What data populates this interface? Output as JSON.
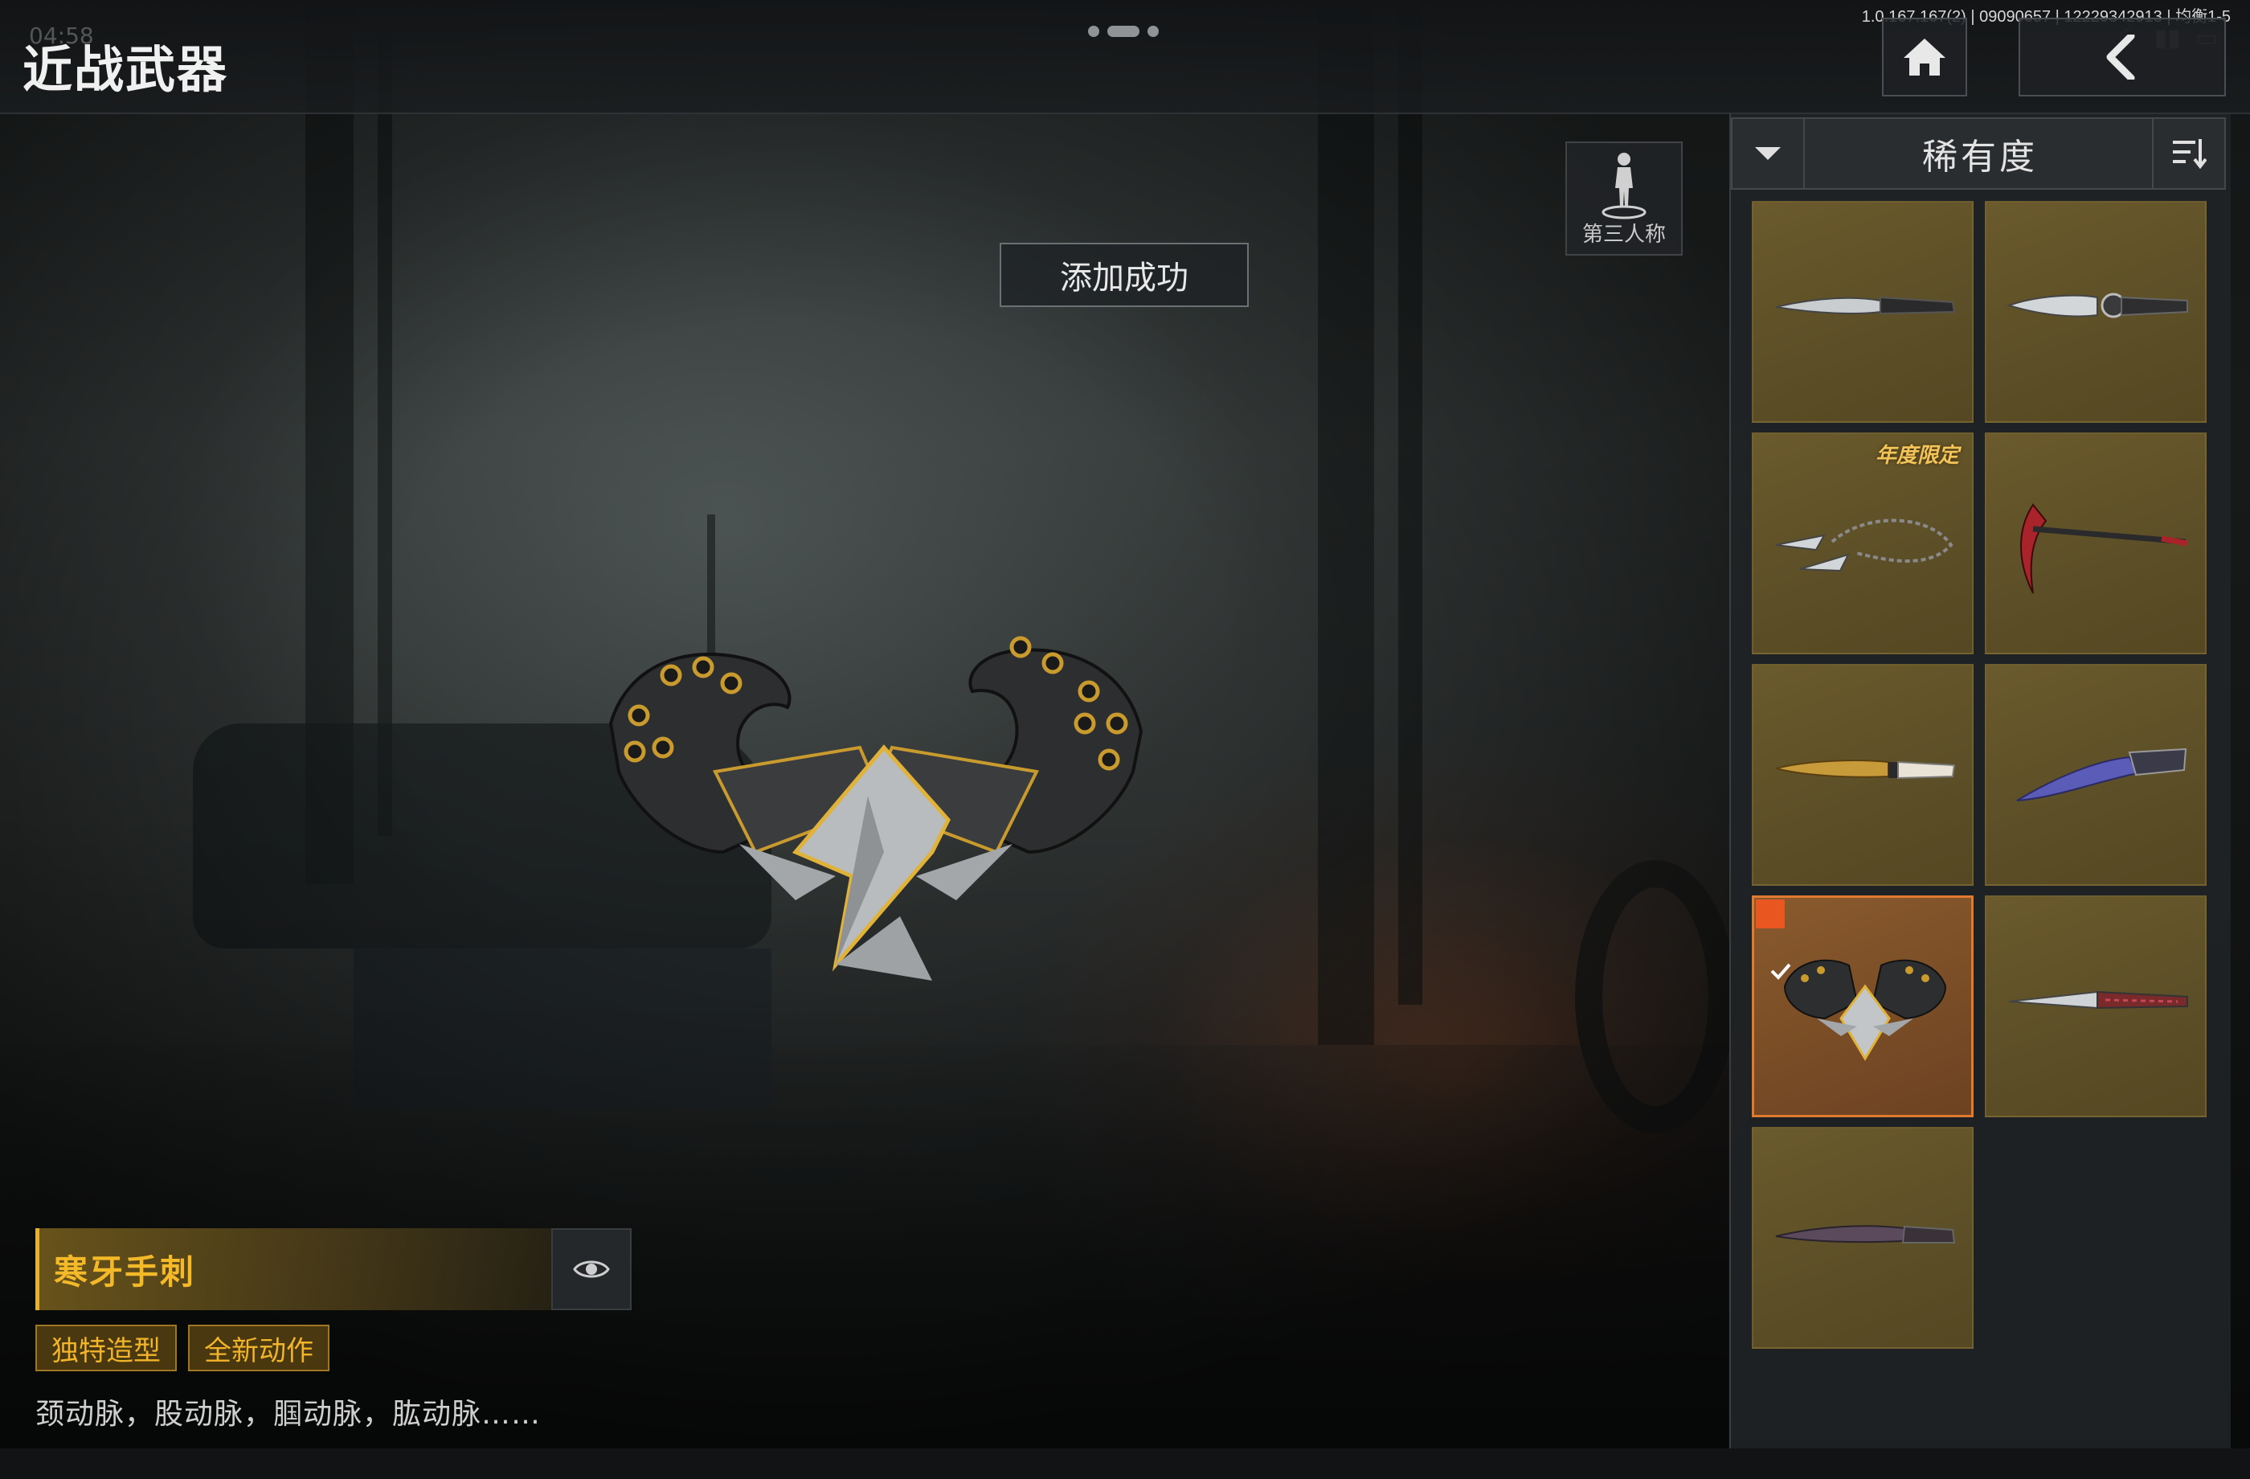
{
  "header": {
    "title": "近战武器",
    "clock": "04:58",
    "build_info": "1.0.167.167(2) | 09090657 | 12229342913 | 均衡1-5"
  },
  "nav": {
    "home_icon": "home-icon",
    "back_icon": "chevron-left-icon"
  },
  "toast": {
    "text": "添加成功"
  },
  "view_toggle": {
    "label": "第三人称",
    "icon": "person-icon"
  },
  "sort": {
    "label": "稀有度",
    "collapse_icon": "chevron-down-icon",
    "order_icon": "sort-order-icon"
  },
  "selected_item": {
    "name": "寒牙手刺",
    "tags": [
      "独特造型",
      "全新动作"
    ],
    "description": "颈动脉，股动脉，腘动脉，肱动脉……",
    "preview_icon": "eye-icon"
  },
  "items": [
    {
      "badge": "",
      "selected": false,
      "icon": "dagger-icon"
    },
    {
      "badge": "",
      "selected": false,
      "icon": "combat-knife-icon"
    },
    {
      "badge": "年度限定",
      "selected": false,
      "icon": "chain-blades-icon"
    },
    {
      "badge": "",
      "selected": false,
      "icon": "scythe-icon"
    },
    {
      "badge": "",
      "selected": false,
      "icon": "golden-knife-icon"
    },
    {
      "badge": "",
      "selected": false,
      "icon": "karambit-icon"
    },
    {
      "badge": "",
      "selected": true,
      "icon": "twin-push-daggers-icon"
    },
    {
      "badge": "",
      "selected": false,
      "icon": "serrated-blade-icon"
    },
    {
      "badge": "",
      "selected": false,
      "icon": "curved-blade-icon"
    }
  ],
  "colors": {
    "accent_gold": "#f4b928",
    "selected_border": "#e07a2e",
    "check_bg": "#e9561f",
    "cell_bg": "#5d4f27"
  }
}
